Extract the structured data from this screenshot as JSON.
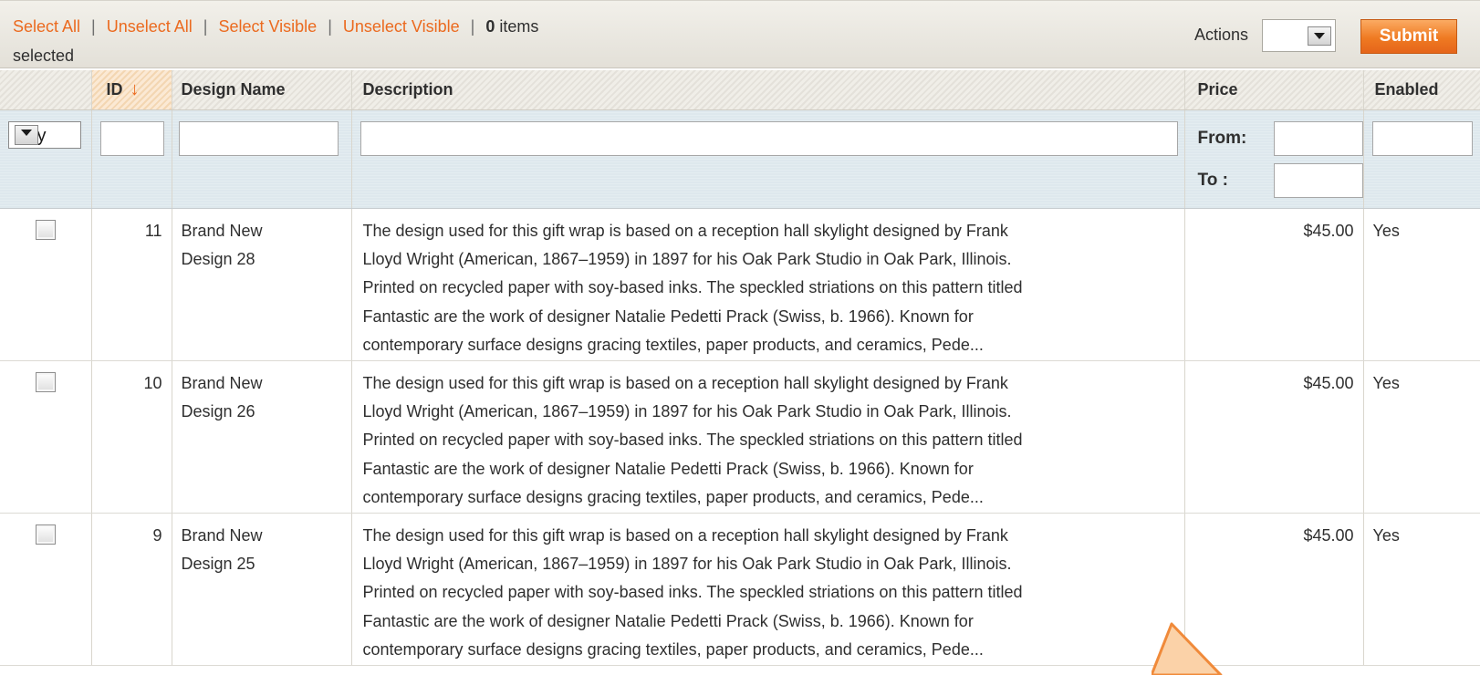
{
  "massaction": {
    "select_all": "Select All",
    "unselect_all": "Unselect All",
    "select_visible": "Select Visible",
    "unselect_visible": "Unselect Visible",
    "separator": "|",
    "count": "0",
    "items_text": "items",
    "selected_text": "selected",
    "actions_label": "Actions",
    "actions_value": "",
    "submit_label": "Submit"
  },
  "columns": {
    "id": "ID",
    "design_name": "Design Name",
    "description": "Description",
    "price": "Price",
    "enabled": "Enabled"
  },
  "filters": {
    "massaction_value": "Any",
    "price_from_label": "From:",
    "price_to_label": "To :",
    "id": "",
    "design_name": "",
    "description": "",
    "price_from": "",
    "price_to": "",
    "enabled": ""
  },
  "rows": [
    {
      "id": "11",
      "name_line1": "Brand New",
      "name_line2": "Design 28",
      "desc_lines": [
        "The design used for this gift wrap is based on a reception hall skylight designed by Frank",
        "Lloyd Wright (American, 1867–1959) in 1897 for his Oak Park Studio in Oak Park, Illinois.",
        "Printed on recycled paper with soy-based inks. The speckled striations on this pattern titled",
        "Fantastic are the work of designer Natalie Pedetti Prack (Swiss, b. 1966). Known for",
        "contemporary surface designs gracing textiles, paper products, and ceramics, Pede..."
      ],
      "price": "$45.00",
      "enabled": "Yes"
    },
    {
      "id": "10",
      "name_line1": "Brand New",
      "name_line2": "Design 26",
      "desc_lines": [
        "The design used for this gift wrap is based on a reception hall skylight designed by Frank",
        "Lloyd Wright (American, 1867–1959) in 1897 for his Oak Park Studio in Oak Park, Illinois.",
        "Printed on recycled paper with soy-based inks. The speckled striations on this pattern titled",
        "Fantastic are the work of designer Natalie Pedetti Prack (Swiss, b. 1966). Known for",
        "contemporary surface designs gracing textiles, paper products, and ceramics, Pede..."
      ],
      "price": "$45.00",
      "enabled": "Yes"
    },
    {
      "id": "9",
      "name_line1": "Brand New",
      "name_line2": "Design 25",
      "desc_lines": [
        "The design used for this gift wrap is based on a reception hall skylight designed by Frank",
        "Lloyd Wright (American, 1867–1959) in 1897 for his Oak Park Studio in Oak Park, Illinois.",
        "Printed on recycled paper with soy-based inks. The speckled striations on this pattern titled",
        "Fantastic are the work of designer Natalie Pedetti Prack (Swiss, b. 1966). Known for",
        "contemporary surface designs gracing textiles, paper products, and ceramics, Pede..."
      ],
      "price": "$45.00",
      "enabled": "Yes"
    }
  ],
  "icons": {
    "sort": "sort-desc-arrow-icon",
    "dropdown": "chevron-down-icon",
    "annotation": "callout-arrow-icon"
  },
  "colors": {
    "link_orange": "#eb6a1f",
    "submit_orange": "#ef7a22",
    "filter_blue": "#dfe9ee",
    "annotation_fill": "#fbd2a8",
    "annotation_stroke": "#f08a3a"
  }
}
